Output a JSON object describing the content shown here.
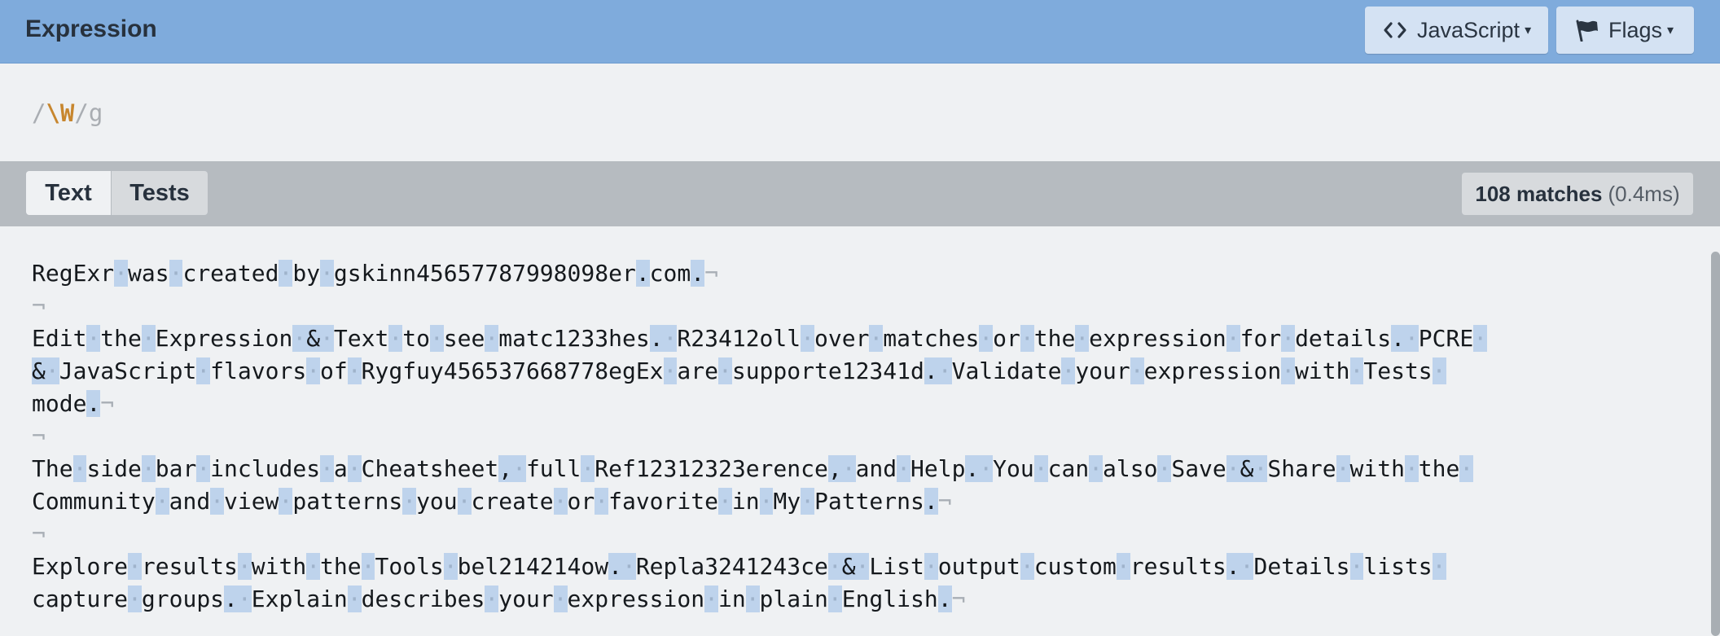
{
  "header": {
    "title": "Expression",
    "language_label": "JavaScript",
    "flags_label": "Flags",
    "caret": "▾"
  },
  "expression": {
    "open_delim": "/",
    "pattern": "\\W",
    "close_delim": "/",
    "flags": "g"
  },
  "tabs": [
    {
      "label": "Text",
      "active": true
    },
    {
      "label": "Tests",
      "active": false
    }
  ],
  "status": {
    "matches": "108 matches",
    "time": "(0.4ms)"
  },
  "text": [
    "RegExr was created by gskinn45657787998098er.com.",
    "",
    "Edit the Expression & Text to see matc1233hes. R23412oll over matches or the expression for details. PCRE ",
    "& JavaScript flavors of Rygfuy456537668778egEx are supporte12341d. Validate your expression with Tests ",
    "mode.",
    "",
    "The side bar includes a Cheatsheet, full Ref12312323erence, and Help. You can also Save & Share with the ",
    "Community and view patterns you create or favorite in My Patterns.",
    "",
    "Explore results with the Tools bel214214ow. Repla3241243ce & List output custom results. Details lists ",
    "capture groups. Explain describes your expression in plain English."
  ],
  "line_end_marks": [
    true,
    true,
    false,
    false,
    true,
    true,
    false,
    true,
    true,
    false,
    true
  ],
  "colors": {
    "header_bg": "#7fabdc",
    "match_highlight": "#bed3ec",
    "escape_color": "#c7862e"
  },
  "icons": {
    "language": "code-brackets-icon",
    "flags": "flag-icon",
    "space": "middle-dot",
    "newline": "pilcrow-not-sign"
  }
}
